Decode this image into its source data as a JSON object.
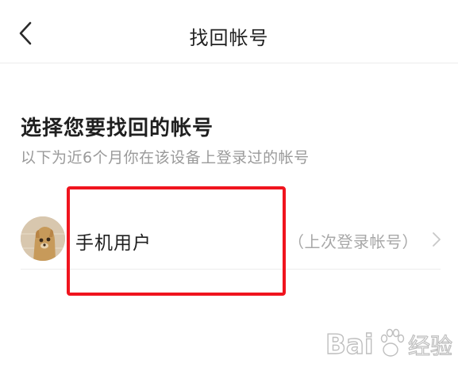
{
  "header": {
    "title": "找回帐号",
    "back_icon": "chevron-left-icon"
  },
  "section": {
    "title": "选择您要找回的帐号",
    "subtitle": "以下为近6个月你在该设备上登录过的帐号"
  },
  "accounts": [
    {
      "name": "手机用户",
      "status": "（上次登录帐号）",
      "avatar_icon": "cartoon-dog-avatar",
      "chevron_icon": "chevron-right-icon"
    }
  ],
  "watermark": {
    "text": "Bai经验",
    "logo": "baidu-paw-logo"
  },
  "colors": {
    "highlight": "#f0141e",
    "text_primary": "#1f1f1f",
    "text_secondary": "#9a9a9a",
    "divider": "#ececec"
  }
}
